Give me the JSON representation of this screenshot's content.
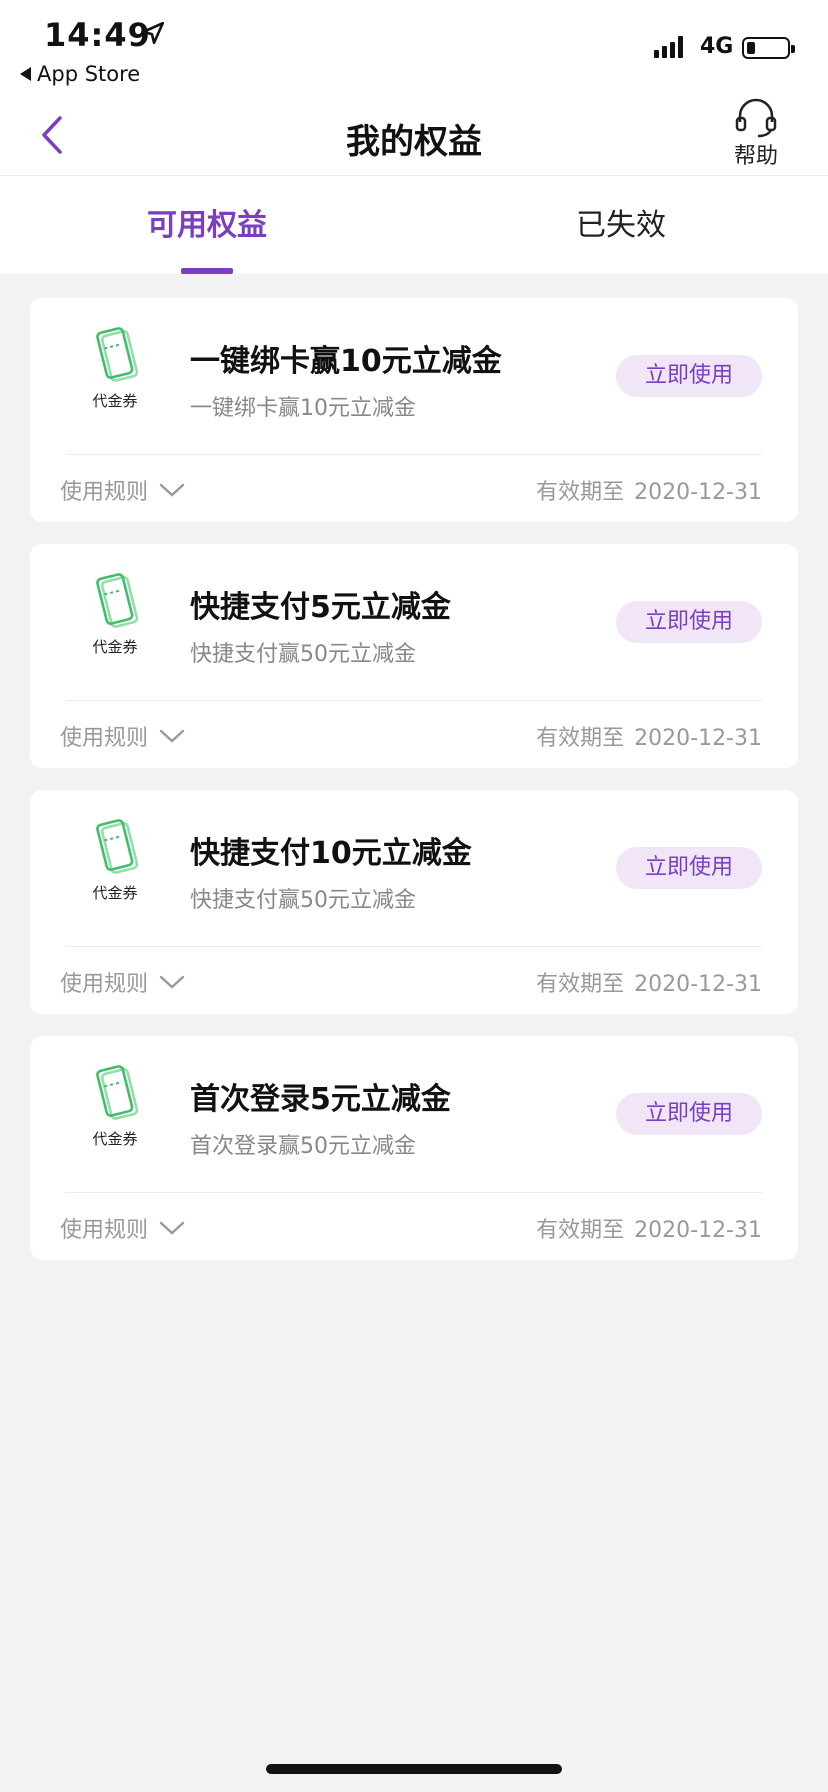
{
  "status_bar": {
    "time": "14:49",
    "back_app": "App Store",
    "network": "4G"
  },
  "header": {
    "title": "我的权益",
    "help_label": "帮助"
  },
  "tabs": [
    {
      "label": "可用权益",
      "active": true
    },
    {
      "label": "已失效",
      "active": false
    }
  ],
  "coupons": [
    {
      "icon_label": "代金券",
      "title": "一键绑卡赢10元立减金",
      "subtitle": "一键绑卡赢10元立减金",
      "button": "立即使用",
      "rules": "使用规则",
      "expiry_label": "有效期至",
      "expiry_date": "2020-12-31"
    },
    {
      "icon_label": "代金券",
      "title": "快捷支付5元立减金",
      "subtitle": "快捷支付赢50元立减金",
      "button": "立即使用",
      "rules": "使用规则",
      "expiry_label": "有效期至",
      "expiry_date": "2020-12-31"
    },
    {
      "icon_label": "代金券",
      "title": "快捷支付10元立减金",
      "subtitle": "快捷支付赢50元立减金",
      "button": "立即使用",
      "rules": "使用规则",
      "expiry_label": "有效期至",
      "expiry_date": "2020-12-31"
    },
    {
      "icon_label": "代金券",
      "title": "首次登录5元立减金",
      "subtitle": "首次登录赢50元立减金",
      "button": "立即使用",
      "rules": "使用规则",
      "expiry_label": "有效期至",
      "expiry_date": "2020-12-31"
    }
  ],
  "colors": {
    "accent": "#7a3fc0",
    "button_bg": "#f0e6f8",
    "coupon_icon": "#3fbf6a",
    "page_bg": "#f2f2f4"
  }
}
